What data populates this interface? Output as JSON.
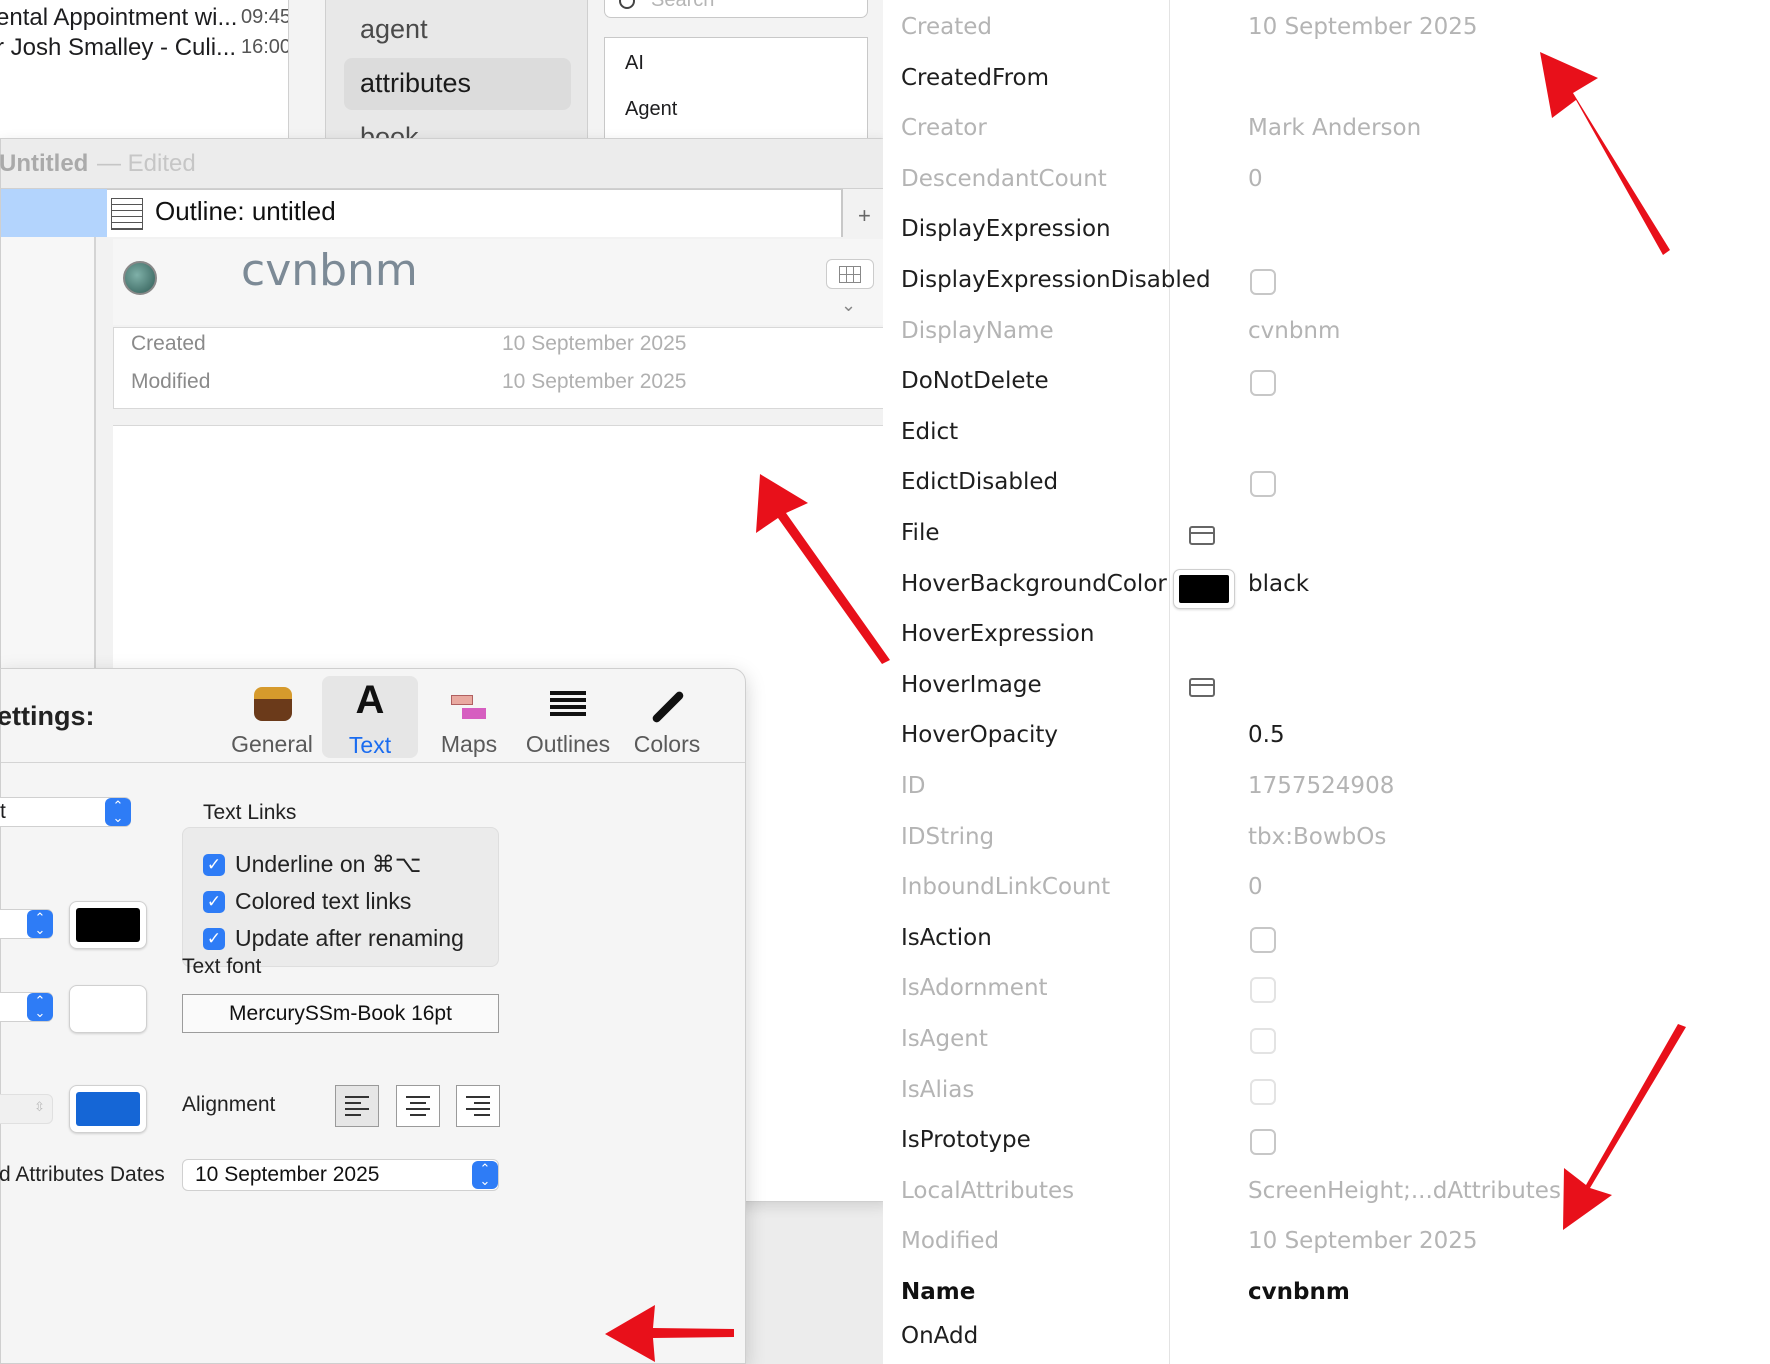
{
  "mail": {
    "items": [
      {
        "title": "ental Appointment wi...",
        "time": "09:45"
      },
      {
        "title": "r Josh Smalley - Culi...",
        "time": "16:00"
      }
    ]
  },
  "sidebar": {
    "items": [
      "agent",
      "attributes",
      "book"
    ]
  },
  "list_panel": {
    "search_placeholder": "Search",
    "items": [
      "AI",
      "Agent"
    ]
  },
  "doc_window": {
    "title": "Untitled",
    "edited": "— Edited",
    "tab_title": "Outline: untitled",
    "add_tab": "+",
    "note_title": "cvnbnm",
    "key_attributes": [
      {
        "name": "Created",
        "value": "10 September 2025"
      },
      {
        "name": "Modified",
        "value": "10 September 2025"
      }
    ]
  },
  "settings": {
    "title": "ettings:",
    "tabs": [
      "General",
      "Text",
      "Maps",
      "Outlines",
      "Colors"
    ],
    "selected_tab": "Text",
    "partial_select_value": "t",
    "text_links_heading": "Text Links",
    "checkboxes": [
      "Underline on ⌘⌥",
      "Colored text links",
      "Update after renaming"
    ],
    "text_font_label": "Text font",
    "text_font_value": "MercurySSm-Book 16pt",
    "alignment_label": "Alignment",
    "dates_label": "d Attributes Dates",
    "dates_value": "10 September 2025",
    "colors": {
      "swatch1": "#000000",
      "swatch2": "#ffffff",
      "swatch3": "#1566d6"
    }
  },
  "inspector": {
    "attributes": [
      {
        "name": "Created",
        "value": "10 September 2025",
        "dim": true
      },
      {
        "name": "CreatedFrom",
        "value": "",
        "dim": false
      },
      {
        "name": "Creator",
        "value": "Mark Anderson",
        "dim": true
      },
      {
        "name": "DescendantCount",
        "value": "0",
        "dim": true
      },
      {
        "name": "DisplayExpression",
        "value": "",
        "dim": false
      },
      {
        "name": "DisplayExpressionDisabled",
        "value": "",
        "dim": false,
        "checkbox": true
      },
      {
        "name": "DisplayName",
        "value": "cvnbnm",
        "dim": true
      },
      {
        "name": "DoNotDelete",
        "value": "",
        "dim": false,
        "checkbox": true
      },
      {
        "name": "Edict",
        "value": "",
        "dim": false
      },
      {
        "name": "EdictDisabled",
        "value": "",
        "dim": false,
        "checkbox": true
      },
      {
        "name": "File",
        "value": "",
        "dim": false,
        "folder": true
      },
      {
        "name": "HoverBackgroundColor",
        "value": "black",
        "dim": false,
        "color": "#000000"
      },
      {
        "name": "HoverExpression",
        "value": "",
        "dim": false
      },
      {
        "name": "HoverImage",
        "value": "",
        "dim": false,
        "folder": true
      },
      {
        "name": "HoverOpacity",
        "value": "0.5",
        "dim": false
      },
      {
        "name": "ID",
        "value": "1757524908",
        "dim": true
      },
      {
        "name": "IDString",
        "value": "tbx:BowbOs",
        "dim": true
      },
      {
        "name": "InboundLinkCount",
        "value": "0",
        "dim": true
      },
      {
        "name": "IsAction",
        "value": "",
        "dim": false,
        "checkbox": true
      },
      {
        "name": "IsAdornment",
        "value": "",
        "dim": true,
        "checkbox": true
      },
      {
        "name": "IsAgent",
        "value": "",
        "dim": true,
        "checkbox": true
      },
      {
        "name": "IsAlias",
        "value": "",
        "dim": true,
        "checkbox": true
      },
      {
        "name": "IsPrototype",
        "value": "",
        "dim": false,
        "checkbox": true
      },
      {
        "name": "LocalAttributes",
        "value": "ScreenHeight;...dAttributes",
        "dim": true
      },
      {
        "name": "Modified",
        "value": "10 September 2025",
        "dim": true
      },
      {
        "name": "Name",
        "value": "cvnbnm",
        "dim": false,
        "bold": true
      },
      {
        "name": "OnAdd",
        "value": "",
        "dim": false
      }
    ]
  },
  "annotation_color": "#e8101a"
}
